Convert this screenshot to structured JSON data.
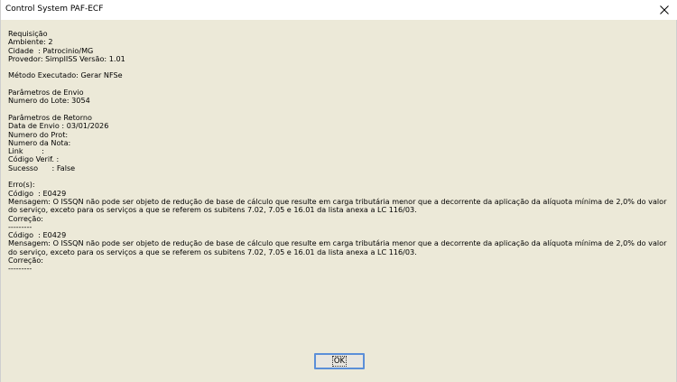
{
  "window": {
    "title": "Control System PAF-ECF",
    "close_icon": "close-icon"
  },
  "message": {
    "req_header": "Requisição",
    "ambiente": "Ambiente: 2",
    "cidade": "Cidade  : Patrocinio/MG",
    "provedor": "Provedor: SimplISS Versão: 1.01",
    "metodo": "Método Executado: Gerar NFSe",
    "envio_header": "Parâmetros de Envio",
    "lote": "Numero do Lote: 3054",
    "retorno_header": "Parâmetros de Retorno",
    "data_envio": "Data de Envio : 03/01/2026",
    "num_prot": "Numero do Prot:",
    "num_nota": "Numero da Nota:",
    "link": "Link        :",
    "cod_verif": "Código Verif. :",
    "sucesso": "Sucesso      : False",
    "erros_header": "Erro(s):",
    "errors": [
      {
        "codigo": "Código  : E0429",
        "mensagem": "Mensagem: O ISSQN não pode ser objeto de redução de base de cálculo que resulte em carga tributária menor que a decorrente da aplicação da alíquota mínima de 2,0% do valor do serviço, exceto para os serviços a que se referem os subitens 7.02, 7.05 e 16.01 da lista anexa a LC 116/03.",
        "correcao": "Correção:",
        "separator": "---------"
      },
      {
        "codigo": "Código  : E0429",
        "mensagem": "Mensagem: O ISSQN não pode ser objeto de redução de base de cálculo que resulte em carga tributária menor que a decorrente da aplicação da alíquota mínima de 2,0% do valor do serviço, exceto para os serviços a que se referem os subitens 7.02, 7.05 e 16.01 da lista anexa a LC 116/03.",
        "correcao": "Correção:",
        "separator": "---------"
      }
    ]
  },
  "buttons": {
    "ok_label": "OK"
  },
  "colors": {
    "dialog_bg": "#ece9d8",
    "titlebar_bg": "#ffffff",
    "button_focus_border": "#5b8fd8"
  }
}
